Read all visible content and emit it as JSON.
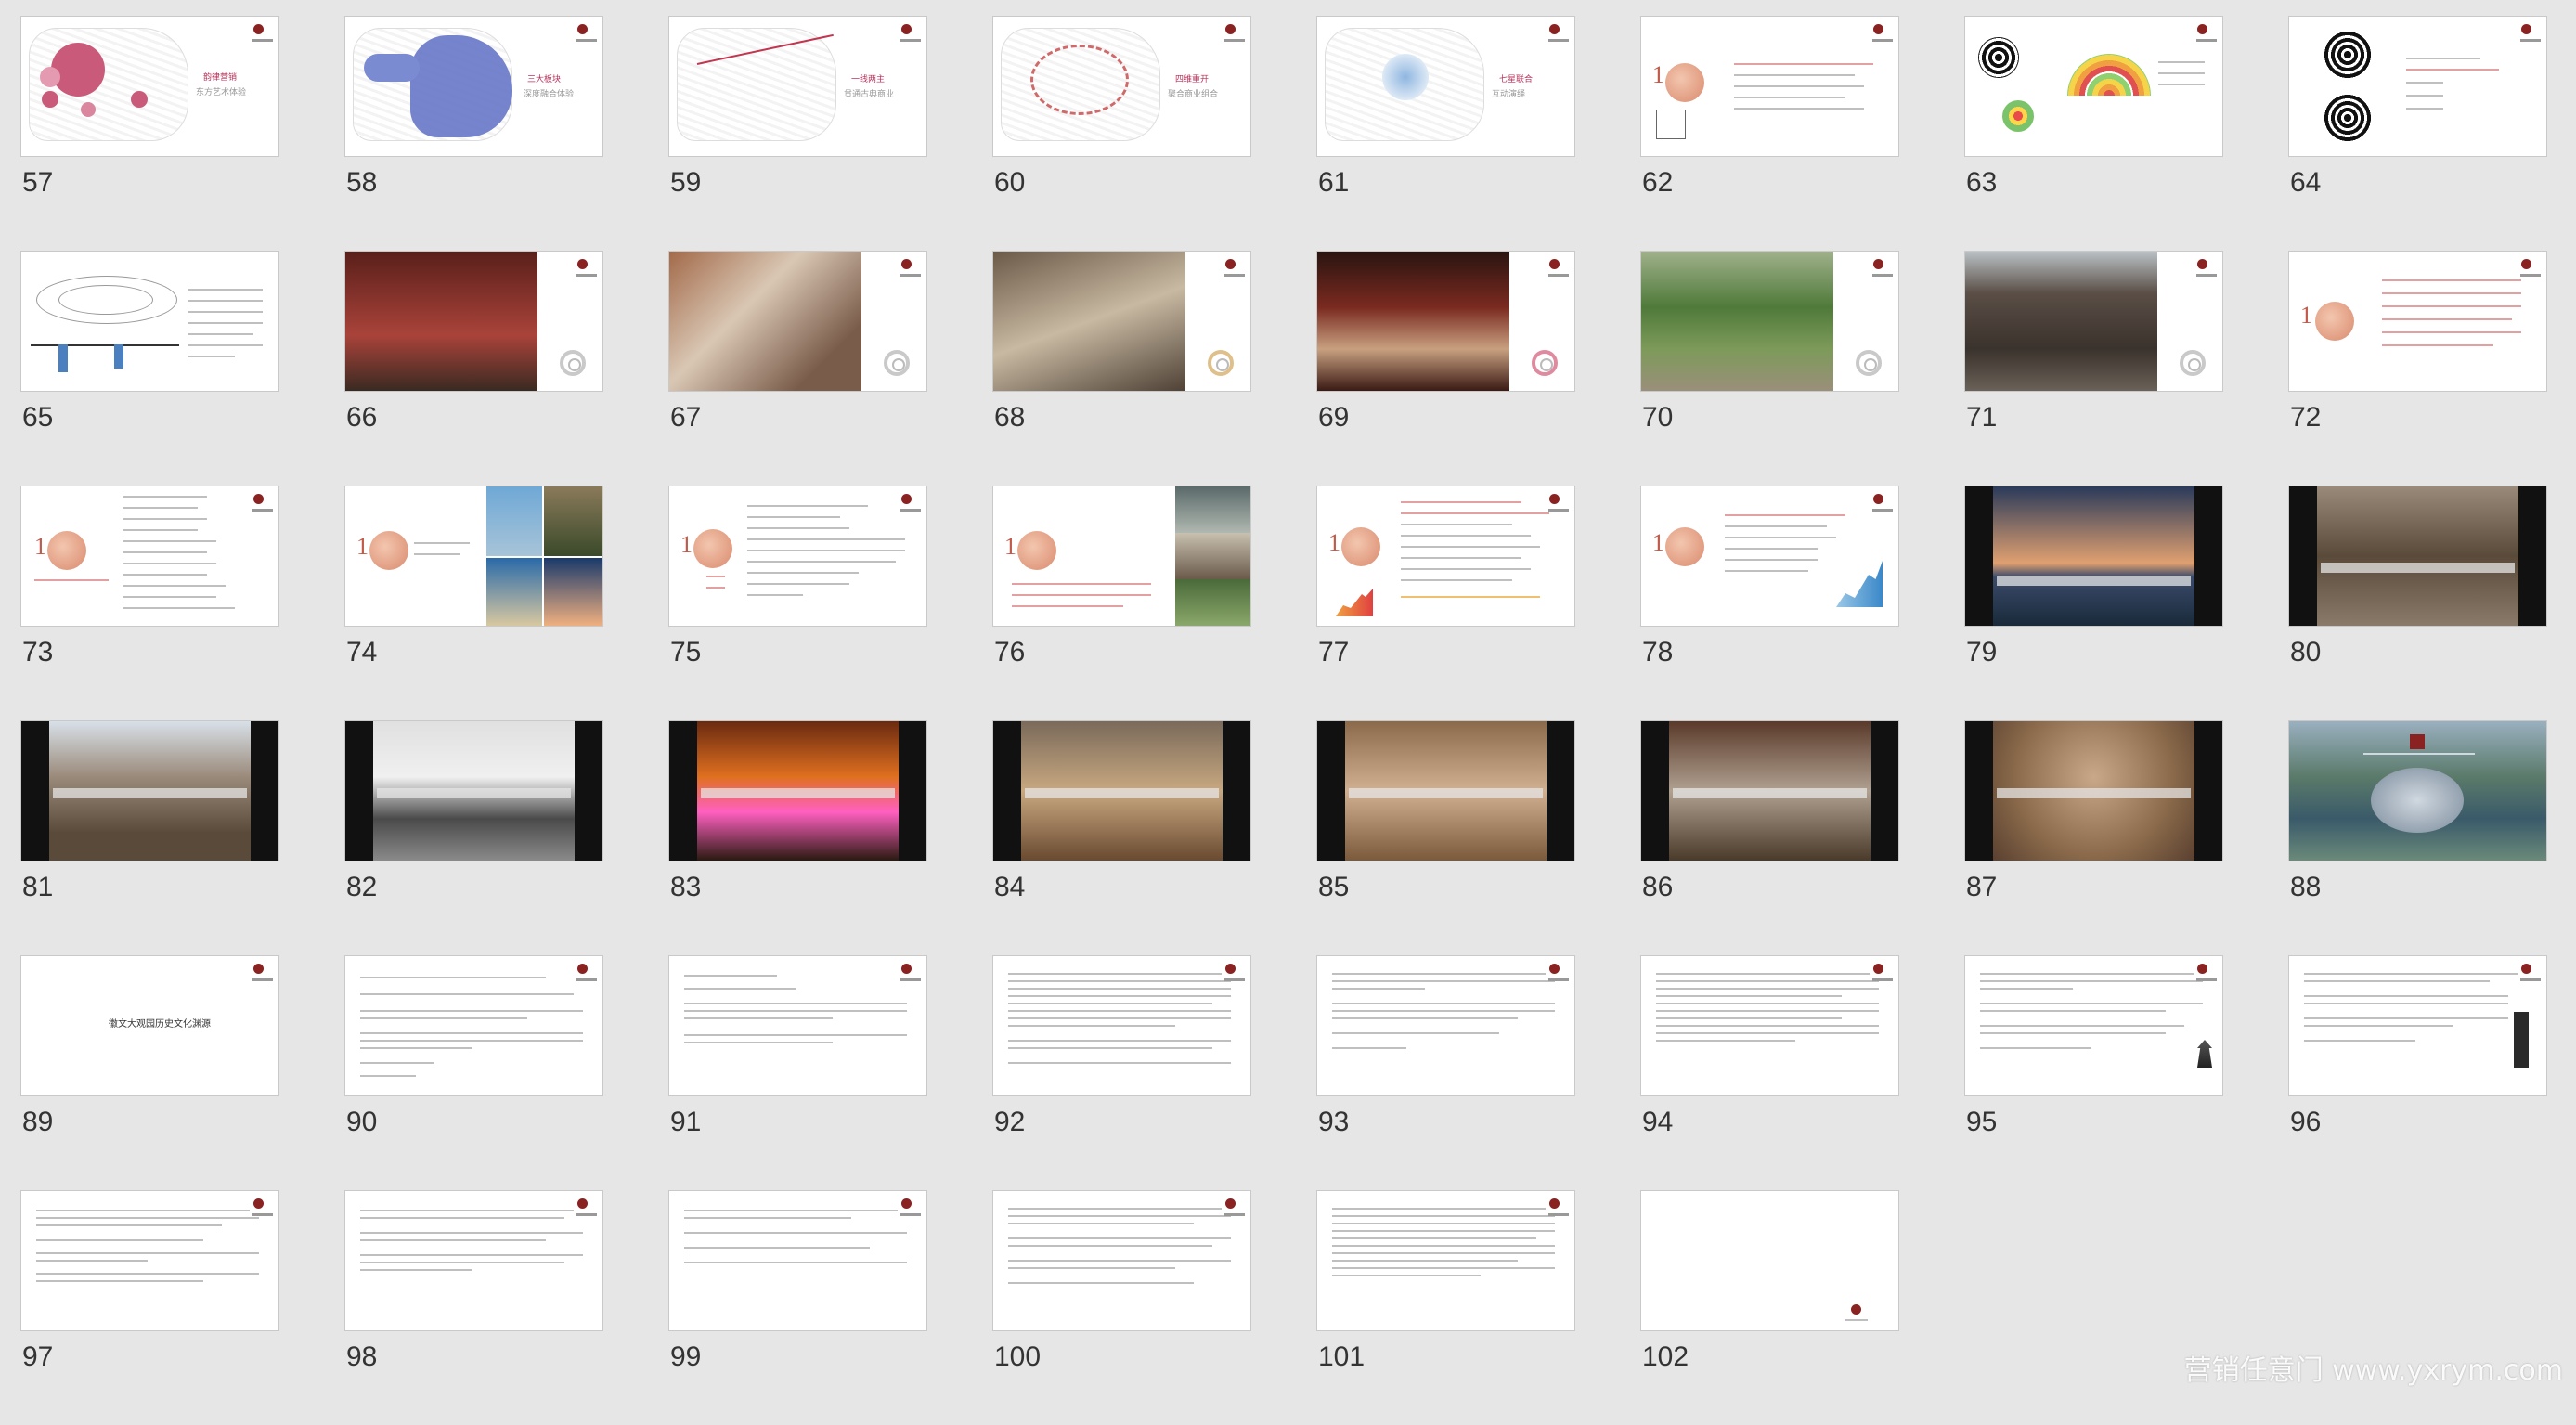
{
  "slides": [
    "57",
    "58",
    "59",
    "60",
    "61",
    "62",
    "63",
    "64",
    "65",
    "66",
    "67",
    "68",
    "69",
    "70",
    "71",
    "72",
    "73",
    "74",
    "75",
    "76",
    "77",
    "78",
    "79",
    "80",
    "81",
    "82",
    "83",
    "84",
    "85",
    "86",
    "87",
    "88",
    "89",
    "90",
    "91",
    "92",
    "93",
    "94",
    "95",
    "96",
    "97",
    "98",
    "99",
    "100",
    "101",
    "102"
  ],
  "captions": {
    "s57": [
      "韵律营销",
      "东方艺术体验"
    ],
    "s58": [
      "三大板块",
      "深度融合体验"
    ],
    "s59": [
      "一线两主",
      "贯通古典商业"
    ],
    "s60": [
      "四维重开",
      "聚合商业组合"
    ],
    "s61": [
      "七星联合",
      "互动演绎"
    ],
    "s89": "徽文大观园历史文化渊源"
  },
  "watermark": "营销任意门 www.yxrym.com",
  "colors": {
    "accent": "#b8325b",
    "brand": "#8a2222",
    "background": "#e6e6e6"
  }
}
